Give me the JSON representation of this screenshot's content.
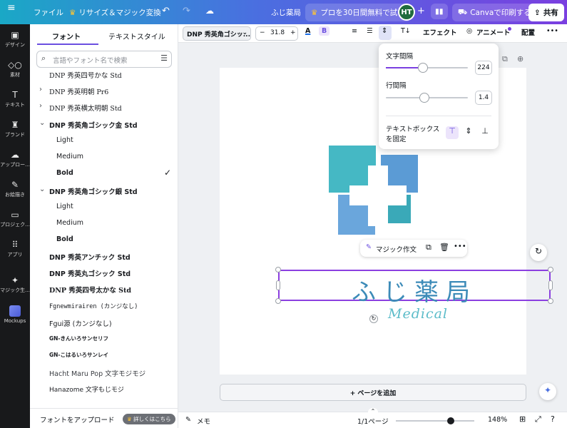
{
  "topbar": {
    "file": "ファイル",
    "resize": "リサイズ＆マジック変換",
    "doc_title": "ふじ薬局",
    "trial": "プロを30日間無料で試す",
    "avatar": "HT",
    "print": "Canvaで印刷する",
    "share": "共有"
  },
  "rail": [
    "デザイン",
    "素材",
    "テキスト",
    "ブランド",
    "アップロー...",
    "お絵描き",
    "プロジェク...",
    "アプリ",
    "マジック生...",
    "Mockups"
  ],
  "panel": {
    "tab_font": "フォント",
    "tab_style": "テキストスタイル",
    "search_placeholder": "言語やフォント名で検索",
    "fonts": [
      {
        "label": "DNP 秀英四号かな Std",
        "chevron": ""
      },
      {
        "label": "DNP 秀英明朝 Pr6",
        "chevron": "›"
      },
      {
        "label": "DNP 秀英横太明朝 Std",
        "chevron": "›"
      },
      {
        "label": "DNP 秀英角ゴシック金 Std",
        "chevron": "⌄"
      },
      {
        "label": "Light",
        "chevron": ""
      },
      {
        "label": "Medium",
        "chevron": ""
      },
      {
        "label": "Bold",
        "chevron": ""
      },
      {
        "label": "DNP 秀英角ゴシック銀 Std",
        "chevron": "⌄"
      },
      {
        "label": "Light",
        "chevron": ""
      },
      {
        "label": "Medium",
        "chevron": ""
      },
      {
        "label": "Bold",
        "chevron": ""
      },
      {
        "label": "DNP 秀英アンチック Std",
        "chevron": ""
      },
      {
        "label": "DNP 秀英丸ゴシック Std",
        "chevron": ""
      },
      {
        "label": "DNP 秀英四号太かな Std",
        "chevron": ""
      },
      {
        "label": "Fgnewmirairen (カンジなし)",
        "chevron": ""
      },
      {
        "label": "Fgui源 (カンジなし)",
        "chevron": ""
      },
      {
        "label": "GN-きんいろサンセリフ",
        "chevron": ""
      },
      {
        "label": "GN-こはるいろサンレイ",
        "chevron": ""
      },
      {
        "label": "Hacht Maru Pop 文字モジモジ",
        "chevron": ""
      },
      {
        "label": "Hanazome 文字もじモジ",
        "chevron": ""
      }
    ],
    "upload": "フォントをアップロード",
    "details": "詳しくはこちら"
  },
  "toolbar": {
    "font_name": "DNP 秀英角ゴシッ...",
    "minus": "−",
    "size": "31.8",
    "plus": "+",
    "color_letter": "A",
    "bold": "B",
    "effects": "エフェクト",
    "animate": "アニメート",
    "position": "配置",
    "more": "•••"
  },
  "spacing_popup": {
    "letter_spacing_label": "文字間隔",
    "letter_spacing_value": "224",
    "letter_spacing_fraction": 0.45,
    "line_spacing_label": "行間隔",
    "line_spacing_value": "1.4",
    "line_spacing_fraction": 0.47,
    "fix_box_label": "テキストボックス",
    "fix_box_label_2": "を固定"
  },
  "canvas": {
    "title": "ふじ薬局",
    "subtitle": "Medical",
    "magic_write": "マジック作文",
    "add_page": "+ ページを追加"
  },
  "bottombar": {
    "memo": "メモ",
    "page": "1/1ページ",
    "zoom": "148%",
    "zoom_fraction": 0.7
  },
  "colors": {
    "accent": "#7a3fe0",
    "logo_teal": "#45b8c4",
    "logo_blue": "#5b9bd5",
    "title_blue": "#3c8bb8"
  }
}
